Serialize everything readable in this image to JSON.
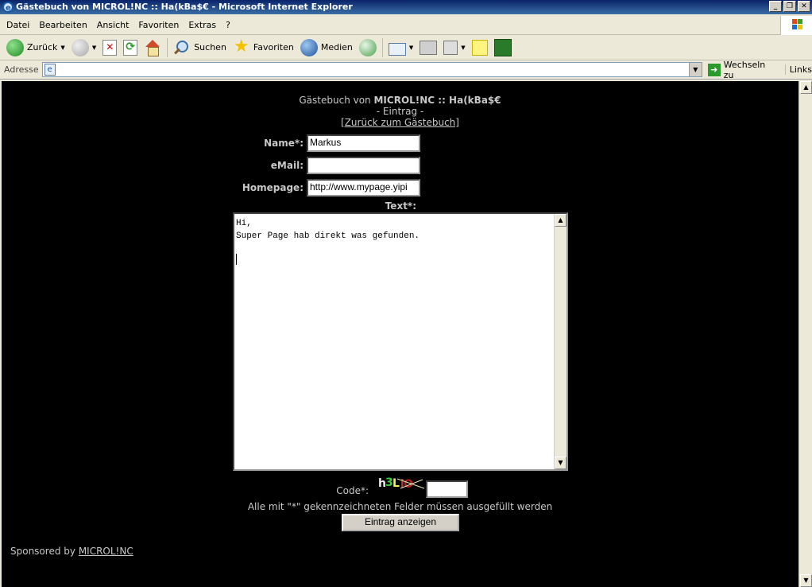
{
  "window": {
    "title": "Gästebuch von MICROL!NC :: Ha(kBa$€ - Microsoft Internet Explorer",
    "buttons": [
      "_",
      "❐",
      "✕"
    ]
  },
  "menu": [
    "Datei",
    "Bearbeiten",
    "Ansicht",
    "Favoriten",
    "Extras",
    "?"
  ],
  "toolbar": {
    "back": "Zurück",
    "search": "Suchen",
    "favorites": "Favoriten",
    "media": "Medien"
  },
  "address": {
    "label": "Adresse",
    "value": "",
    "go": "Wechseln zu",
    "links": "Links"
  },
  "page": {
    "title_prefix": "Gästebuch von",
    "title_bold": "MICROL!NC :: Ha(kBa$€",
    "subtitle": "- Eintrag -",
    "back_link": "[Zurück zum Gästebuch]",
    "form": {
      "name_label": "Name*:",
      "name_value": "Markus",
      "email_label": "eMail:",
      "email_value": "",
      "homepage_label": "Homepage:",
      "homepage_value": "http://www.mypage.yipi",
      "text_label": "Text*:",
      "text_value": "Hi,\nSuper Page hab direkt was gefunden.",
      "code_label": "Code*:",
      "captcha_chars": [
        "h",
        "3",
        "L",
        "i",
        "O"
      ],
      "code_value": "",
      "required_note": "Alle mit \"*\" gekennzeichneten Felder müssen ausgefüllt werden",
      "submit": "Eintrag anzeigen"
    },
    "sponsor_prefix": "Sponsored by",
    "sponsor_link": "MICROL!NC"
  },
  "colors": {
    "background": "#000000",
    "text": "#c8c8c8",
    "titlebar": "#0a246a"
  }
}
